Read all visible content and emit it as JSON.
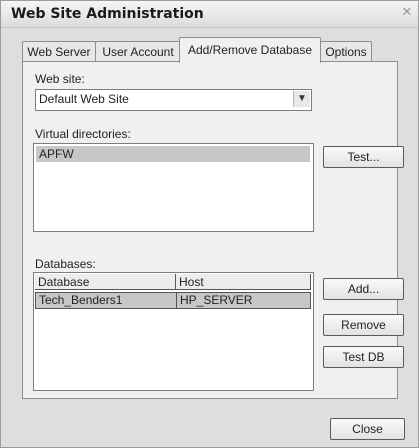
{
  "window": {
    "title": "Web Site Administration",
    "close_glyph": "✕"
  },
  "tabs": [
    {
      "label": "Web Server",
      "active": false
    },
    {
      "label": "User Account",
      "active": false
    },
    {
      "label": "Add/Remove Database",
      "active": true
    },
    {
      "label": "Options",
      "active": false
    }
  ],
  "website": {
    "label": "Web site:",
    "selected": "Default Web Site",
    "arrow_icon": "chevron-down-icon"
  },
  "virtual_dirs": {
    "label": "Virtual directories:",
    "items": [
      "APFW"
    ],
    "test_button": "Test..."
  },
  "databases": {
    "label": "Databases:",
    "columns": [
      "Database",
      "Host"
    ],
    "rows": [
      {
        "database": "Tech_Benders1",
        "host": "HP_SERVER"
      }
    ],
    "add_button": "Add...",
    "remove_button": "Remove",
    "testdb_button": "Test DB"
  },
  "footer": {
    "close_button": "Close"
  }
}
